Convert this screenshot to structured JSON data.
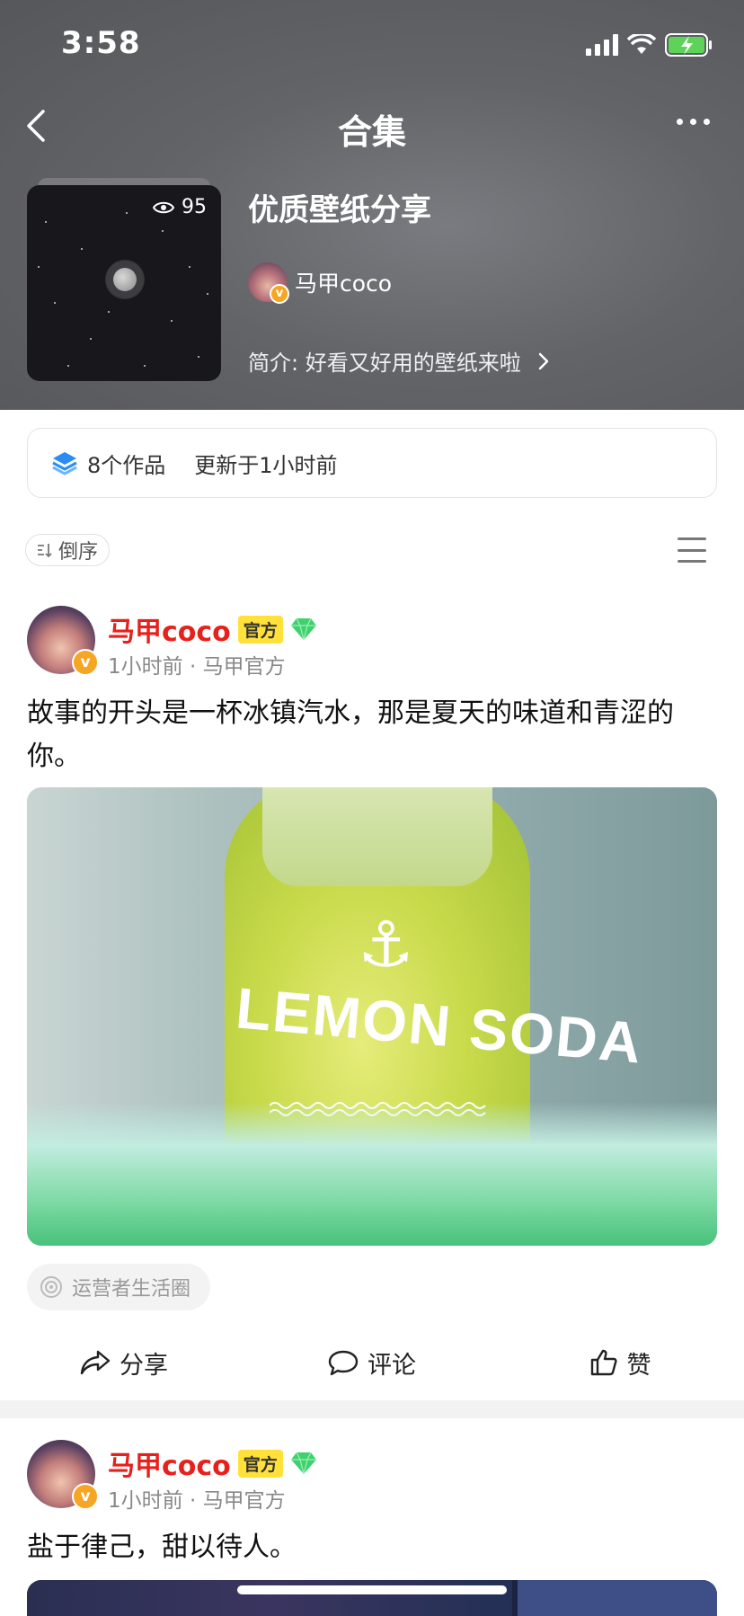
{
  "status": {
    "time": "3:58"
  },
  "nav": {
    "title": "合集"
  },
  "collection": {
    "title": "优质壁纸分享",
    "views": "95",
    "author": "马甲coco",
    "intro": "简介: 好看又好用的壁纸来啦"
  },
  "stats": {
    "works": "8个作品",
    "updated": "更新于1小时前"
  },
  "sort": {
    "label": "倒序"
  },
  "posts": [
    {
      "author": "马甲coco",
      "badge": "官方",
      "meta": "1小时前 · 马甲官方",
      "text": "故事的开头是一杯冰镇汽水，那是夏天的味道和青涩的你。",
      "image_text": "LEMON SODA",
      "circle": "运营者生活圈"
    },
    {
      "author": "马甲coco",
      "badge": "官方",
      "meta": "1小时前 · 马甲官方",
      "text": "盐于律己，甜以待人。"
    }
  ],
  "actions": {
    "share": "分享",
    "comment": "评论",
    "like": "赞"
  },
  "colors": {
    "header_bg": "#636468",
    "name_red": "#e8201c",
    "badge_yellow": "#ffe13a",
    "vip_orange": "#f5a623"
  }
}
